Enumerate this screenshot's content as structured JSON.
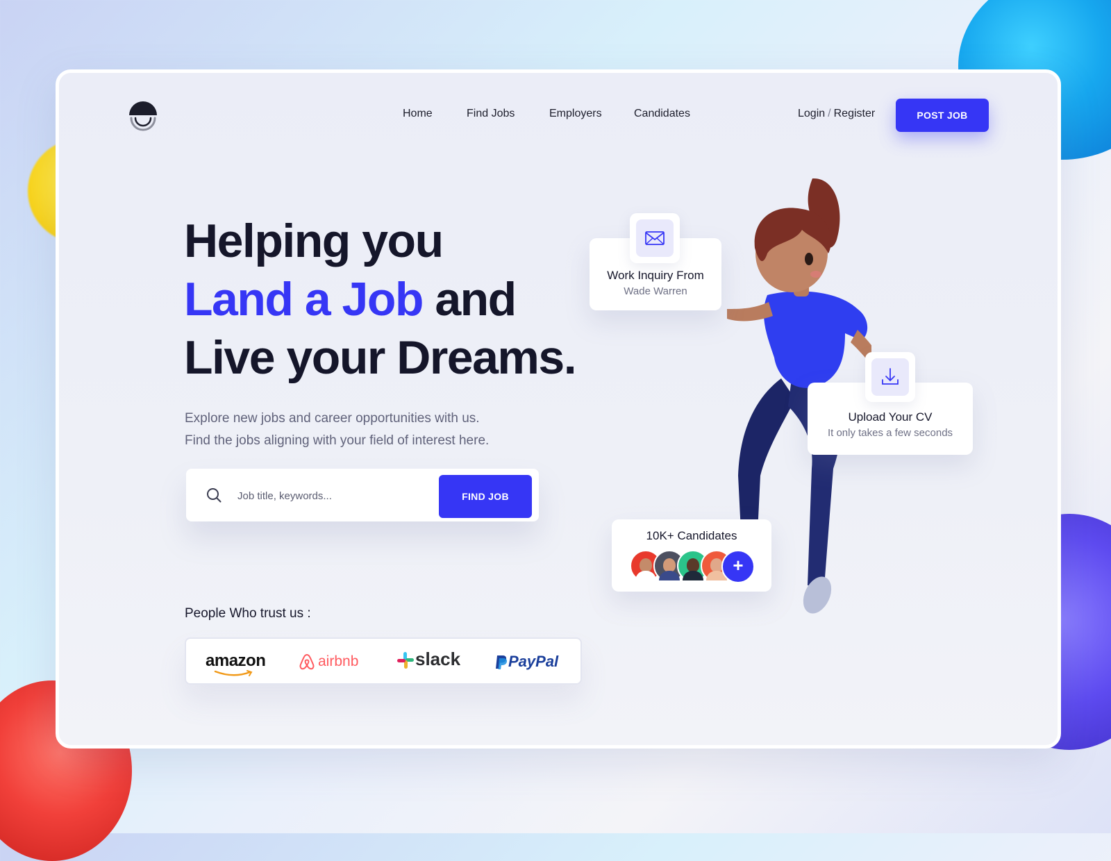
{
  "nav": {
    "items": [
      {
        "label": "Home"
      },
      {
        "label": "Find Jobs"
      },
      {
        "label": "Employers"
      },
      {
        "label": "Candidates"
      }
    ],
    "login_label": "Login",
    "auth_separator": "/",
    "register_label": "Register",
    "post_job_label": "POST JOB"
  },
  "hero": {
    "line1": "Helping you",
    "line2_accent": "Land a Job",
    "line2_rest": " and",
    "line3": "Live your Dreams.",
    "subtitle_line1": "Explore new jobs and career opportunities with us.",
    "subtitle_line2": "Find the jobs aligning with your field of interest here."
  },
  "search": {
    "placeholder": "Job title, keywords...",
    "button_label": "FIND JOB"
  },
  "trust": {
    "label": "People Who trust us :",
    "brands": [
      "amazon",
      "airbnb",
      "slack",
      "PayPal"
    ]
  },
  "cards": {
    "work_inquiry": {
      "title": "Work Inquiry From",
      "subtitle": "Wade Warren"
    },
    "upload_cv": {
      "title": "Upload Your CV",
      "subtitle": "It only takes a few seconds"
    },
    "candidates": {
      "title": "10K+ Candidates",
      "plus": "+"
    }
  },
  "colors": {
    "accent": "#3636f5",
    "heading": "#15162a",
    "body_text": "#60627a",
    "airbnb": "#ff5a5f",
    "paypal_dark": "#1b3f9b",
    "paypal_light": "#1b8ee0"
  },
  "icons": [
    "logo-mark",
    "search-icon",
    "mail-icon",
    "download-icon",
    "plus-icon"
  ]
}
